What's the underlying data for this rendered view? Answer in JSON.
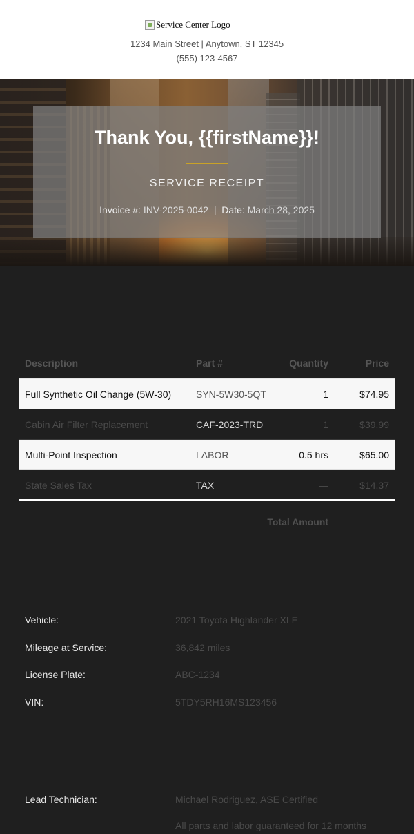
{
  "header": {
    "logo_alt": "Service Center Logo",
    "address": "1234 Main Street | Anytown, ST 12345",
    "phone": "(555) 123-4567"
  },
  "hero": {
    "title": "Thank You, {{firstName}}!",
    "subtitle": "SERVICE RECEIPT",
    "invoice_label": "Invoice #:",
    "invoice_number": "INV-2025-0042",
    "separator": "|",
    "date_label": "Date:",
    "date": "March 28, 2025"
  },
  "table": {
    "headers": [
      "Description",
      "Part #",
      "Quantity",
      "Price"
    ],
    "rows": [
      {
        "description": "Full Synthetic Oil Change (5W-30)",
        "part": "SYN-5W30-5QT",
        "quantity": "1",
        "price": "$74.95"
      },
      {
        "description": "Cabin Air Filter Replacement",
        "part": "CAF-2023-TRD",
        "quantity": "1",
        "price": "$39.99"
      },
      {
        "description": "Multi-Point Inspection",
        "part": "LABOR",
        "quantity": "0.5 hrs",
        "price": "$65.00"
      },
      {
        "description": "State Sales Tax",
        "part": "TAX",
        "quantity": "—",
        "price": "$14.37"
      }
    ],
    "total_label": "Total Amount"
  },
  "vehicle": {
    "rows": [
      {
        "label": "Vehicle:",
        "value": "2021 Toyota Highlander XLE"
      },
      {
        "label": "Mileage at Service:",
        "value": "36,842 miles"
      },
      {
        "label": "License Plate:",
        "value": "ABC-1234"
      },
      {
        "label": "VIN:",
        "value": "5TDY5RH16MS123456"
      }
    ]
  },
  "service": {
    "rows": [
      {
        "label": "Lead Technician:",
        "value": "Michael Rodriguez, ASE Certified"
      },
      {
        "label": "",
        "value": "All parts and labor guaranteed for 12 months"
      }
    ]
  },
  "colors": {
    "accent_gold": "#c9a227",
    "background_dark": "#1f1f1f",
    "header_bg": "#ffffff"
  }
}
